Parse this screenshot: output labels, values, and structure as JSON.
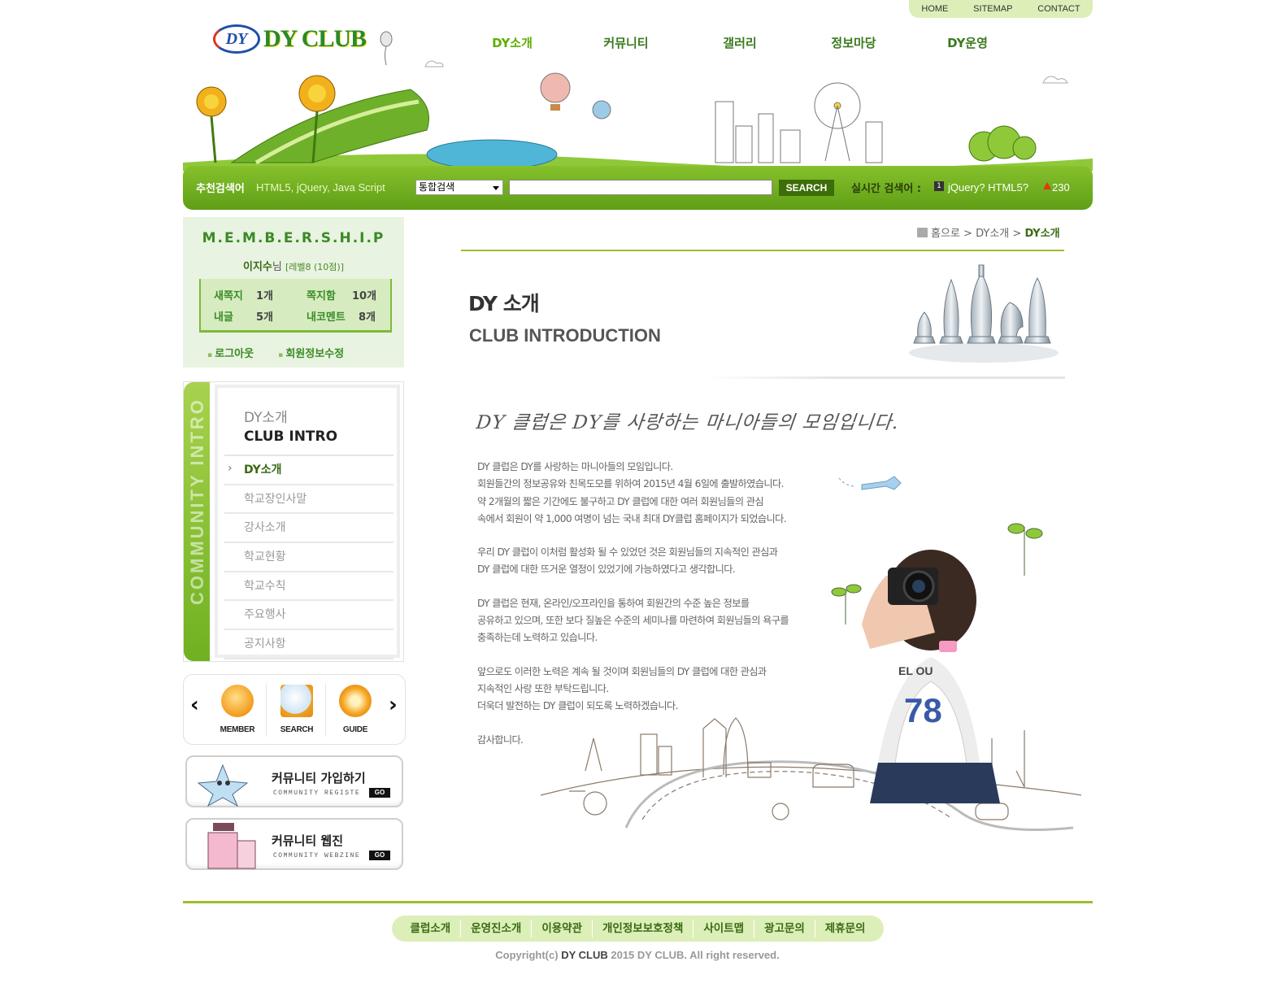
{
  "topnav": [
    "HOME",
    "SITEMAP",
    "CONTACT"
  ],
  "logo": {
    "mark": "DY",
    "text": "DY CLUB"
  },
  "mainnav": [
    "DY소개",
    "커뮤니티",
    "갤러리",
    "정보마당",
    "DY운영"
  ],
  "search": {
    "label": "추천검색어",
    "recommend": "HTML5, jQuery, Java Script",
    "select": "통합검색",
    "button": "SEARCH",
    "realtime_label": "실시간 검색어 :",
    "rank": "1",
    "keyword": "jQuery? HTML5?",
    "count": "230"
  },
  "membership": {
    "title": "M.E.M.B.E.R.S.H.I.P",
    "user": "이지수",
    "suffix": "님",
    "level": "[레벨8 (10점)]",
    "stats": {
      "new_note_label": "새쪽지",
      "new_note": "1개",
      "inbox_label": "쪽지함",
      "inbox": "10개",
      "posts_label": "내글",
      "posts": "5개",
      "comments_label": "내코멘트",
      "comments": "8개"
    },
    "logout": "로그아웃",
    "edit": "회원정보수정"
  },
  "sidemenu": {
    "vertical": "COMMUNITY INTRO",
    "title": "DY소개",
    "subtitle": "CLUB INTRO",
    "items": [
      "DY소개",
      "학교장인사말",
      "강사소개",
      "학교현황",
      "학교수칙",
      "주요행사",
      "공지사항"
    ]
  },
  "quicklinks": [
    "MEMBER",
    "SEARCH",
    "GUIDE"
  ],
  "banners": {
    "join_title": "커뮤니티 가입하기",
    "join_sub": "COMMUNITY REGISTE",
    "webzine_title": "커뮤니티 웹진",
    "webzine_sub": "COMMUNITY WEBZINE",
    "go": "GO"
  },
  "breadcrumb": {
    "home": "홈으로",
    "sep": ">",
    "level1": "DY소개",
    "current": "DY소개"
  },
  "page": {
    "title": "DY 소개",
    "subtitle": "CLUB INTRODUCTION",
    "slogan": "DY 클럽은 DY를 사랑하는 마니아들의 모임입니다.",
    "paragraphs": [
      [
        "DY 클럽은 DY를 사랑하는 마니아들의 모임입니다.",
        "회원들간의 정보공유와 친목도모를 위하여 2015년 4월 6일에 출발하였습니다.",
        "약 2개월의 짧은 기간에도 불구하고 DY 클럽에 대한 여러 회원님들의 관심",
        "속에서 회원이 약 1,000 여명이 넘는 국내 최대 DY클럽 홈페이지가 되었습니다."
      ],
      [
        "우리 DY 클럽이 이처럼 활성화 될 수 있었던 것은 회원님들의 지속적인 관심과",
        "DY 클럽에 대한 뜨거운 열정이 있었기에 가능하였다고 생각합니다."
      ],
      [
        "DY 클럽은 현재, 온라인/오프라인을 통하여 회원간의 수준 높은 정보를",
        "공유하고 있으며, 또한 보다 질높은 수준의 세미나를 마련하여 회원님들의 욕구를",
        "충족하는데 노력하고 있습니다."
      ],
      [
        "앞으로도 이러한 노력은 계속 될 것이며 회원님들의 DY 클럽에 대한 관심과",
        "지속적인 사랑 또한 부탁드립니다.",
        "더욱더 발전하는 DY 클럽이 되도록 노력하겠습니다."
      ],
      [
        "감사합니다."
      ]
    ]
  },
  "footer": {
    "links": [
      "클럽소개",
      "운영진소개",
      "이용약관",
      "개인정보보호정책",
      "사이트맵",
      "광고문의",
      "제휴문의"
    ],
    "copy_prefix": "Copyright(c)",
    "copy_brand": "DY CLUB",
    "copy_rest": "2015 DY CLUB. All right reserved."
  }
}
